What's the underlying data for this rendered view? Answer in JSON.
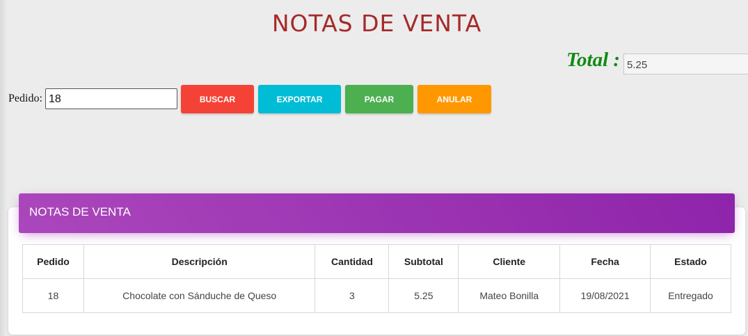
{
  "page": {
    "title": "NOTAS DE VENTA"
  },
  "total": {
    "label": "Total :",
    "value": "5.25"
  },
  "search": {
    "label": "Pedido:",
    "value": "18"
  },
  "buttons": {
    "buscar": "BUSCAR",
    "exportar": "EXPORTAR",
    "pagar": "PAGAR",
    "anular": "ANULAR"
  },
  "card": {
    "title": "NOTAS DE VENTA"
  },
  "table": {
    "headers": [
      "Pedido",
      "Descripción",
      "Cantidad",
      "Subtotal",
      "Cliente",
      "Fecha",
      "Estado"
    ],
    "rows": [
      [
        "18",
        "Chocolate con Sánduche de Queso",
        "3",
        "5.25",
        "Mateo Bonilla",
        "19/08/2021",
        "Entregado"
      ]
    ]
  },
  "colors": {
    "title": "#a52a2a",
    "total_label": "#118a11",
    "buscar": "#f44336",
    "exportar": "#00bcd4",
    "pagar": "#4caf50",
    "anular": "#ff9800",
    "card_header": "#9c27b0"
  }
}
